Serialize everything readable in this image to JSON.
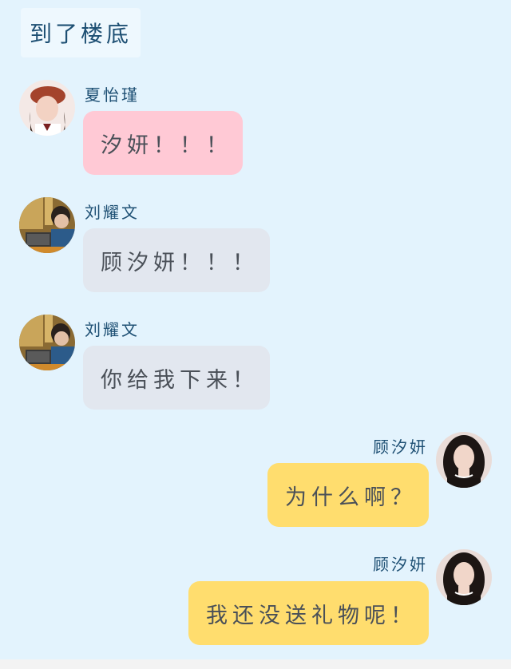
{
  "header": {
    "title": "到了楼底"
  },
  "messages": [
    {
      "sender": "夏怡瑾",
      "text": "汐妍！！！",
      "side": "left",
      "bubble_color": "#ffc9d5",
      "avatar": "girl-red-beret-avatar"
    },
    {
      "sender": "刘耀文",
      "text": "顾汐妍！！！",
      "side": "left",
      "bubble_color": "#e2e7ef",
      "avatar": "boy-laptop-avatar"
    },
    {
      "sender": "刘耀文",
      "text": "你给我下来！",
      "side": "left",
      "bubble_color": "#e2e7ef",
      "avatar": "boy-laptop-avatar"
    },
    {
      "sender": "顾汐妍",
      "text": "为什么啊？",
      "side": "right",
      "bubble_color": "#ffdd6e",
      "avatar": "girl-dark-hair-avatar"
    },
    {
      "sender": "顾汐妍",
      "text": "我还没送礼物呢！",
      "side": "right",
      "bubble_color": "#ffdd6e",
      "avatar": "girl-dark-hair-avatar"
    }
  ],
  "colors": {
    "background": "#e3f3fd",
    "name_text": "#1d4f73",
    "bubble_text": "#4a5058"
  }
}
